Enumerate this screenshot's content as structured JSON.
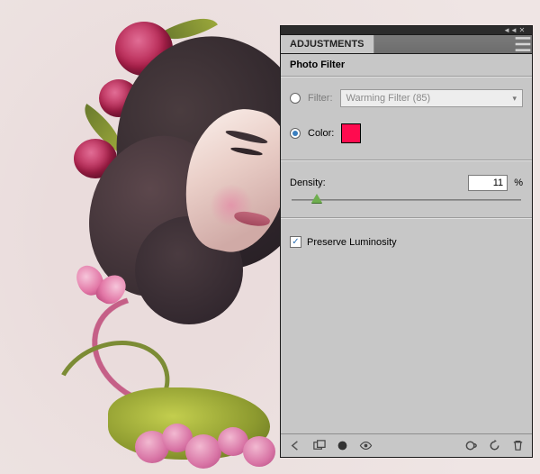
{
  "panel": {
    "tab_label": "ADJUSTMENTS",
    "section_title": "Photo Filter",
    "filter": {
      "label": "Filter:",
      "selected": "Warming Filter (85)",
      "checked": false
    },
    "color": {
      "label": "Color:",
      "swatch_hex": "#ff0b4f",
      "checked": true
    },
    "density": {
      "label": "Density:",
      "value": "11",
      "unit": "%",
      "slider_percent": 11
    },
    "preserve_luminosity": {
      "label": "Preserve Luminosity",
      "checked": true
    }
  },
  "collapse_icons": {
    "left": "◄◄",
    "close": "✕"
  },
  "footer_icons": {
    "back": "back-arrow-icon",
    "doc": "layer-badge-icon",
    "circle": "mask-circle-icon",
    "eye": "visibility-eye-icon",
    "clip": "clip-icon",
    "reset": "reset-icon",
    "trash": "trash-icon"
  }
}
